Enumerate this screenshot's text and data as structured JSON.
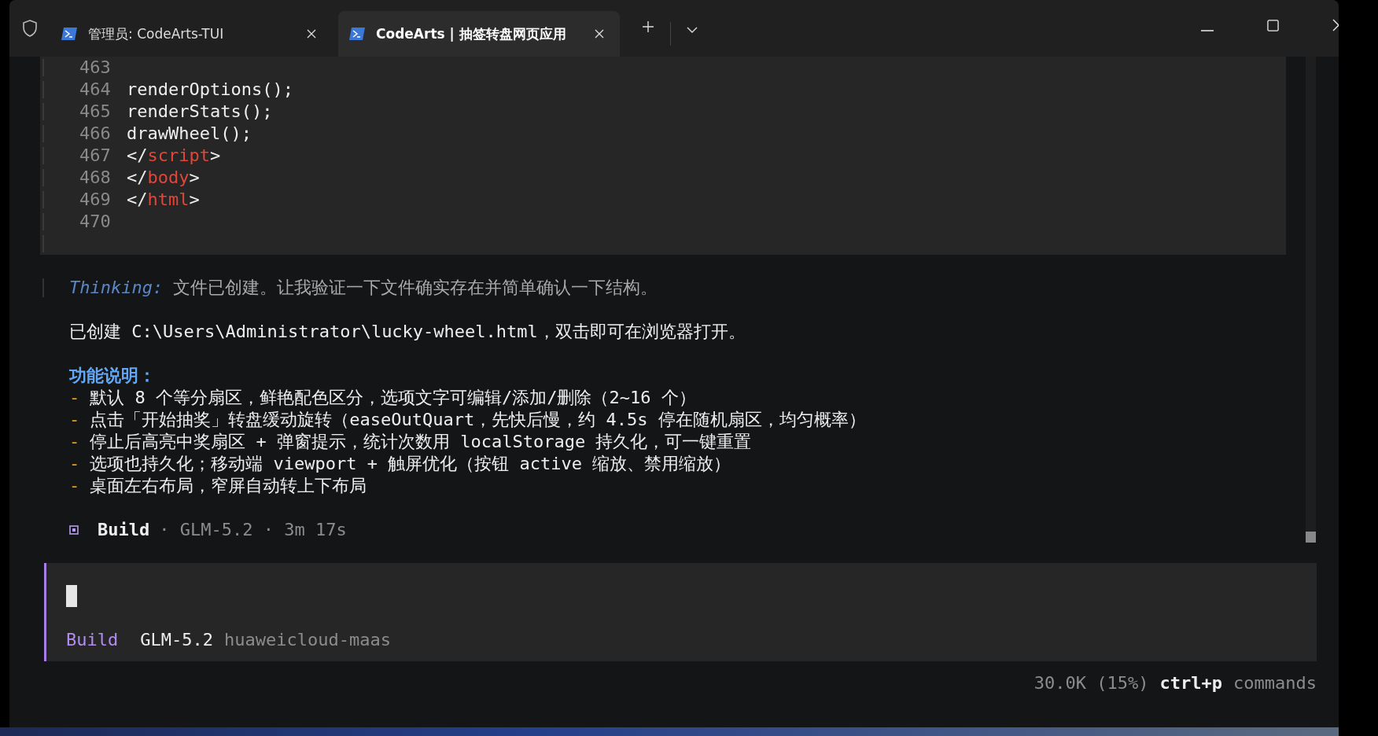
{
  "tabs": [
    {
      "title": "管理员: CodeArts-TUI",
      "selected": false
    },
    {
      "title": "CodeArts | 抽签转盘网页应用",
      "selected": true
    }
  ],
  "code_block": {
    "lines": [
      {
        "number": "463"
      },
      {
        "number": "464",
        "tokens": [
          {
            "text": "renderOptions();",
            "kind": "plain"
          }
        ]
      },
      {
        "number": "465",
        "tokens": [
          {
            "text": "renderStats();",
            "kind": "plain"
          }
        ]
      },
      {
        "number": "466",
        "tokens": [
          {
            "text": "drawWheel();",
            "kind": "plain"
          }
        ]
      },
      {
        "number": "467",
        "tokens": [
          {
            "text": "</",
            "kind": "plain"
          },
          {
            "text": "script",
            "kind": "tag"
          },
          {
            "text": ">",
            "kind": "plain"
          }
        ]
      },
      {
        "number": "468",
        "tokens": [
          {
            "text": "</",
            "kind": "plain"
          },
          {
            "text": "body",
            "kind": "tag"
          },
          {
            "text": ">",
            "kind": "plain"
          }
        ]
      },
      {
        "number": "469",
        "tokens": [
          {
            "text": "</",
            "kind": "plain"
          },
          {
            "text": "html",
            "kind": "tag"
          },
          {
            "text": ">",
            "kind": "plain"
          }
        ]
      },
      {
        "number": "470"
      }
    ]
  },
  "thinking": {
    "label": "Thinking:",
    "text": "文件已创建。让我验证一下文件确实存在并简单确认一下结构。"
  },
  "message": "已创建 C:\\Users\\Administrator\\lucky-wheel.html，双击即可在浏览器打开。",
  "features": {
    "heading": "功能说明：",
    "items": [
      {
        "marker": "-",
        "text": "默认 8 个等分扇区，鲜艳配色区分，选项文字可编辑/添加/删除（2~16 个）"
      },
      {
        "marker": "-",
        "text": "点击「开始抽奖」转盘缓动旋转（easeOutQuart，先快后慢，约 4.5s 停在随机扇区，均匀概率）"
      },
      {
        "marker": "-",
        "text": "停止后高亮中奖扇区 + 弹窗提示，统计次数用 localStorage 持久化，可一键重置"
      },
      {
        "marker": "-",
        "text": "选项也持久化；移动端 viewport + 触屏优化（按钮 active 缩放、禁用缩放）"
      },
      {
        "marker": "-",
        "text": "桌面左右布局，窄屏自动转上下布局"
      }
    ]
  },
  "build_footer": {
    "agent": "Build",
    "details": "· GLM-5.2 · 3m 17s"
  },
  "input": {
    "agent": "Build",
    "model": "GLM-5.2",
    "provider": "huaweicloud-maas"
  },
  "status_bar": {
    "tokens": "30.0K (15%)",
    "shortcut": "ctrl+p",
    "shortcut_label": "commands"
  }
}
